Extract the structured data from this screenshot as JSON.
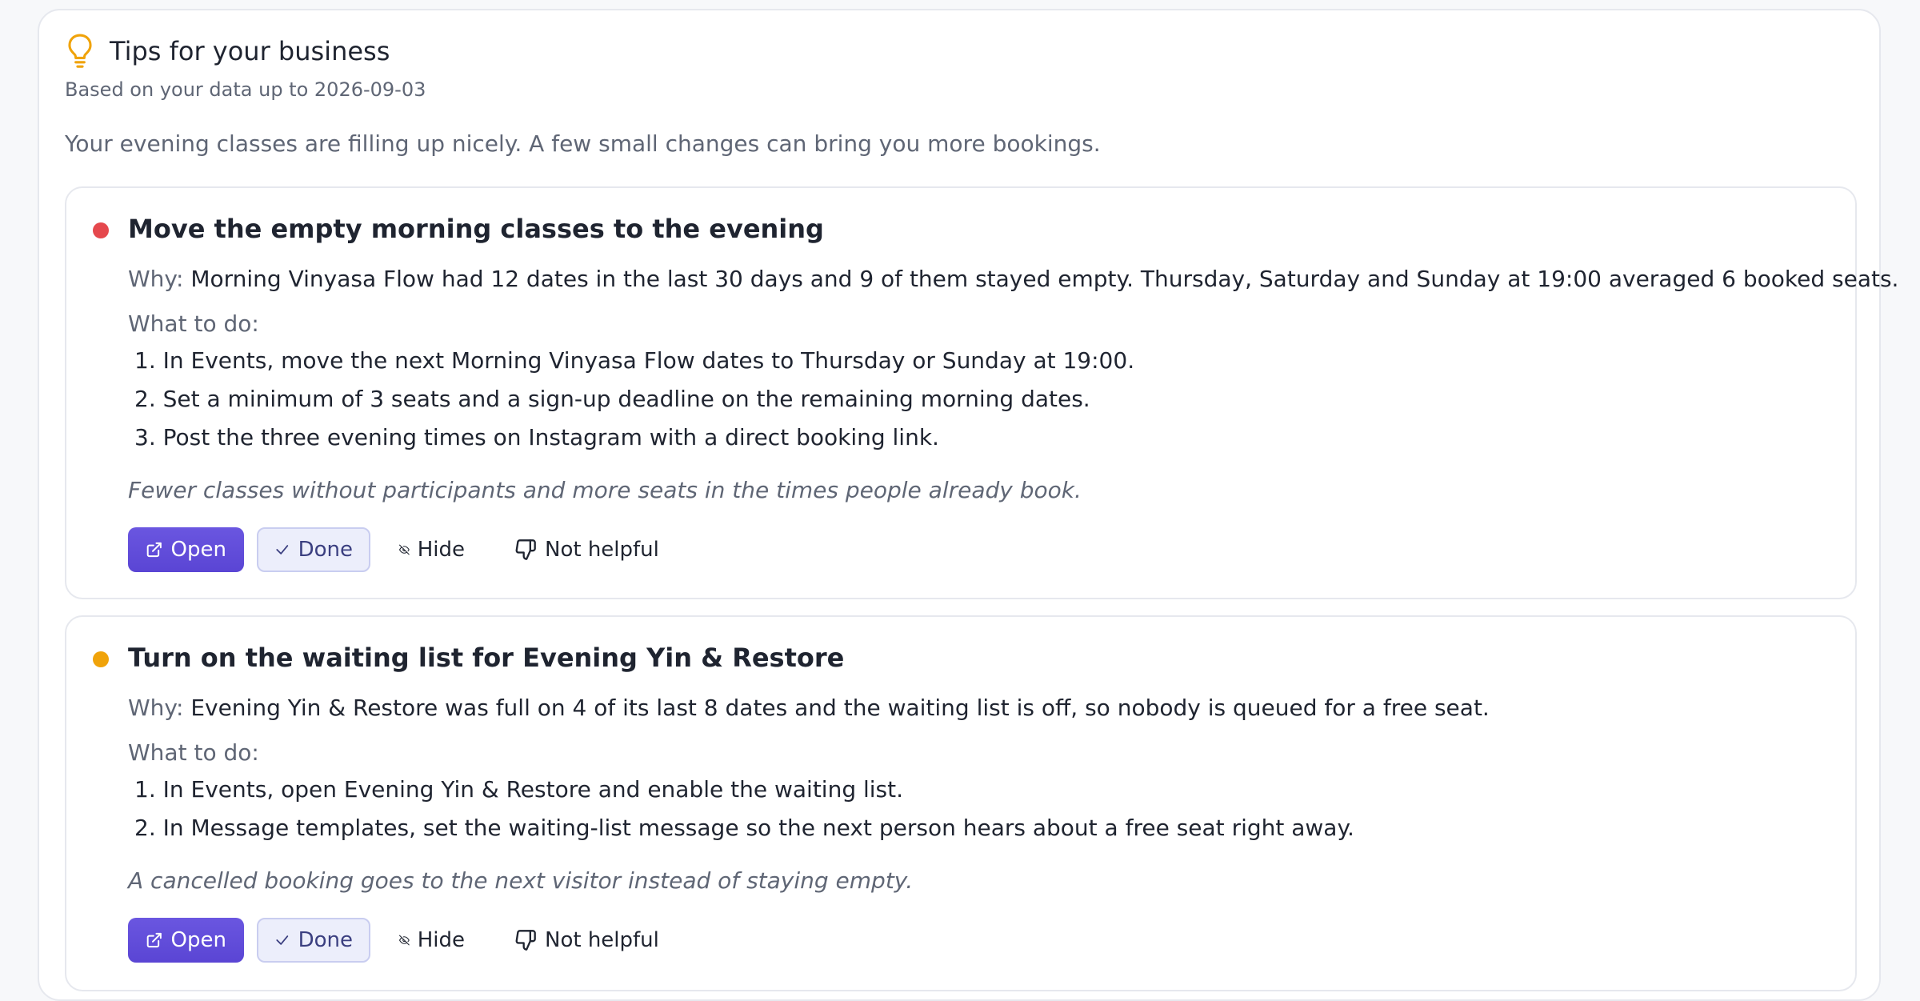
{
  "header": {
    "title": "Tips for your business",
    "subtitle": "Based on your data up to 2026-09-03",
    "intro": "Your evening classes are filling up nicely. A few small changes can bring you more bookings."
  },
  "tips": [
    {
      "title": "Move the empty morning classes to the evening",
      "priority_color": "#e5484d",
      "why_label": "Why:",
      "why_text": "Morning Vinyasa Flow had 12 dates in the last 30 days and 9 of them stayed empty. Thursday, Saturday and Sunday at 19:00 averaged 6 booked seats.",
      "todo_label": "What to do:",
      "steps": [
        "1. In Events, move the next Morning Vinyasa Flow dates to Thursday or Sunday at 19:00.",
        "2. Set a minimum of 3 seats and a sign-up deadline on the remaining morning dates.",
        "3. Post the three evening times on Instagram with a direct booking link."
      ],
      "outcome": "Fewer classes without participants and more seats in the times people already book."
    },
    {
      "title": "Turn on the waiting list for Evening Yin & Restore",
      "priority_color": "#f0a30a",
      "why_label": "Why:",
      "why_text": "Evening Yin & Restore was full on 4 of its last 8 dates and the waiting list is off, so nobody is queued for a free seat.",
      "todo_label": "What to do:",
      "steps": [
        "1. In Events, open Evening Yin & Restore and enable the waiting list.",
        "2. In Message templates, set the waiting-list message so the next person hears about a free seat right away."
      ],
      "outcome": "A cancelled booking goes to the next visitor instead of staying empty."
    }
  ],
  "actions": {
    "open": "Open",
    "done": "Done",
    "hide": "Hide",
    "not_helpful": "Not helpful"
  },
  "colors": {
    "accent": "#5a45d4",
    "bulb": "#f0a30a"
  }
}
